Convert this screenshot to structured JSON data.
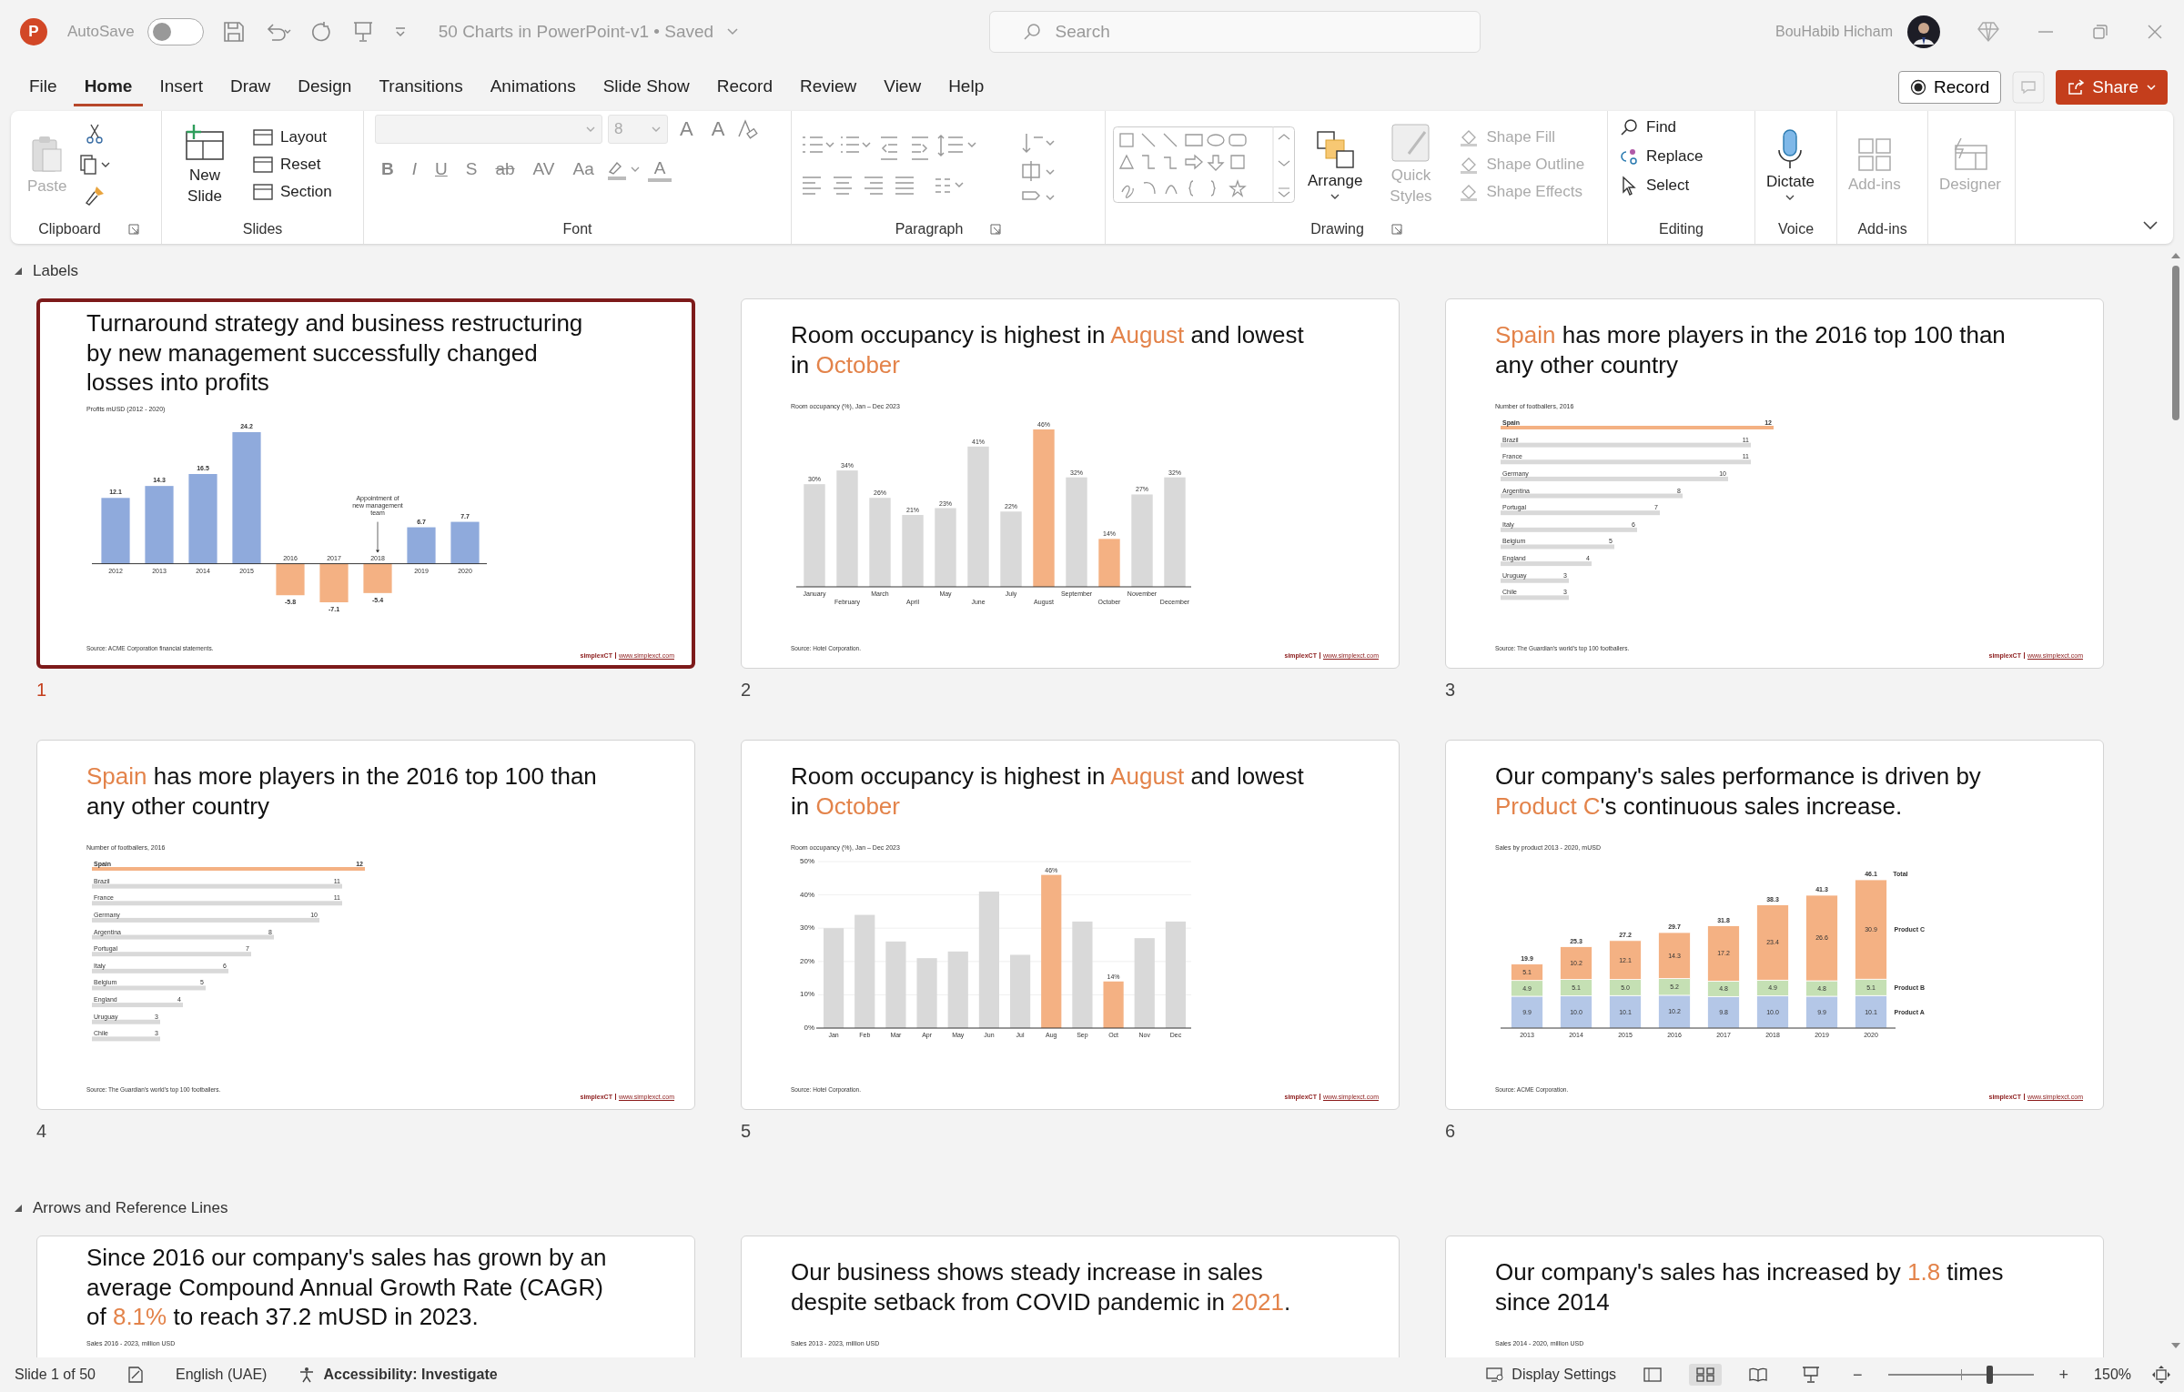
{
  "titlebar": {
    "app_letter": "P",
    "autosave": {
      "label": "AutoSave",
      "on": false
    },
    "document": "50 Charts in PowerPoint-v1 • Saved",
    "search": {
      "placeholder": "Search"
    },
    "user": "BouHabib Hicham"
  },
  "menu": [
    {
      "label": "File",
      "selected": false
    },
    {
      "label": "Home",
      "selected": true
    },
    {
      "label": "Insert",
      "selected": false
    },
    {
      "label": "Draw",
      "selected": false
    },
    {
      "label": "Design",
      "selected": false
    },
    {
      "label": "Transitions",
      "selected": false
    },
    {
      "label": "Animations",
      "selected": false
    },
    {
      "label": "Slide Show",
      "selected": false
    },
    {
      "label": "Record",
      "selected": false
    },
    {
      "label": "Review",
      "selected": false
    },
    {
      "label": "View",
      "selected": false
    },
    {
      "label": "Help",
      "selected": false
    }
  ],
  "record_button": "Record",
  "share_button": "Share",
  "ribbon": {
    "clipboard": {
      "label": "Clipboard",
      "paste": {
        "label": "Paste",
        "disabled": true
      }
    },
    "slides": {
      "label": "Slides",
      "new_slide": "New Slide",
      "items": [
        "Layout",
        "Reset",
        "Section"
      ]
    },
    "font": {
      "label": "Font",
      "size": "8",
      "size_buttons": [
        "A",
        "A"
      ],
      "format_buttons": [
        "B",
        "I",
        "U",
        "S",
        "ab",
        "AV",
        "Aa"
      ],
      "color_letter": "A"
    },
    "paragraph": {
      "label": "Paragraph"
    },
    "drawing": {
      "label": "Drawing",
      "arrange": "Arrange",
      "quick_styles": {
        "label": "Quick Styles",
        "disabled": true
      },
      "shape_items": [
        {
          "label": "Shape Fill",
          "disabled": true
        },
        {
          "label": "Shape Outline",
          "disabled": true
        },
        {
          "label": "Shape Effects",
          "disabled": true
        }
      ]
    },
    "editing": {
      "label": "Editing",
      "items": [
        "Find",
        "Replace",
        "Select"
      ]
    },
    "voice": {
      "label": "Voice",
      "dictate": "Dictate"
    },
    "addins": {
      "label": "Add-ins",
      "button": {
        "label": "Add-ins",
        "disabled": true
      }
    },
    "designer": {
      "button": {
        "label": "Designer",
        "disabled": true
      }
    }
  },
  "sections": [
    {
      "name": "Labels",
      "expanded": true,
      "slides": [
        {
          "number": "1",
          "selected": true,
          "title": [
            {
              "text": "Turnaround strategy and business restructuring by new management successfully changed losses into profits",
              "accent": false
            }
          ],
          "subtitle": "Profits mUSD (2012 - 2020)",
          "source": "Source: ACME Corporation financial statements.",
          "brand": "simplexCT",
          "link": "www.simplexct.com",
          "chart_data": {
            "type": "bar",
            "categories": [
              "2012",
              "2013",
              "2014",
              "2015",
              "2016",
              "2017",
              "2018",
              "2019",
              "2020"
            ],
            "stacked": true,
            "data_labels": true,
            "series": [
              {
                "color": "#8faadc",
                "values": [
                  12.1,
                  14.3,
                  16.5,
                  24.2,
                  null,
                  null,
                  null,
                  6.7,
                  7.7
                ]
              },
              {
                "color": "#f4b183",
                "values": [
                  null,
                  null,
                  null,
                  null,
                  -5.8,
                  -7.1,
                  -5.4,
                  null,
                  null
                ]
              }
            ],
            "annotations": [
              {
                "text": "Appointment of new management team",
                "x": "2018"
              }
            ]
          }
        },
        {
          "number": "2",
          "selected": false,
          "title": [
            {
              "text": "Room occupancy is highest in ",
              "accent": false
            },
            {
              "text": "August",
              "accent": true
            },
            {
              "text": " and lowest in ",
              "accent": false
            },
            {
              "text": "October",
              "accent": true
            }
          ],
          "subtitle": "Room occupancy (%), Jan – Dec 2023",
          "source": "Source: Hotel Corporation.",
          "brand": "simplexCT",
          "link": "www.simplexct.com",
          "chart_data": {
            "type": "bar",
            "categories": [
              "January",
              "February",
              "March",
              "April",
              "May",
              "June",
              "July",
              "August",
              "September",
              "October",
              "November",
              "December"
            ],
            "stacked": true,
            "series": [
              {
                "color": "#d9d9d9",
                "values": [
                  30,
                  34,
                  26,
                  21,
                  23,
                  41,
                  22,
                  null,
                  32,
                  null,
                  27,
                  32
                ],
                "value_labels": [
                  "30%",
                  "34%",
                  "26%",
                  "21%",
                  "23%",
                  "41%",
                  "22%",
                  null,
                  "32%",
                  null,
                  "27%",
                  "32%"
                ]
              },
              {
                "color": "#f4b183",
                "values": [
                  null,
                  null,
                  null,
                  null,
                  null,
                  null,
                  null,
                  46,
                  null,
                  14,
                  null,
                  null
                ],
                "value_labels": [
                  null,
                  null,
                  null,
                  null,
                  null,
                  null,
                  null,
                  "46%",
                  null,
                  "14%",
                  null,
                  null
                ]
              }
            ],
            "data_labels": "value_labels"
          }
        },
        {
          "number": "3",
          "selected": false,
          "title": [
            {
              "text": "Spain",
              "accent": true
            },
            {
              "text": " has more players in the 2016 top 100 than any other country",
              "accent": false
            }
          ],
          "subtitle": "Number of footballers, 2016",
          "source": "Source: The Guardian's world's top 100 footballers.",
          "brand": "simplexCT",
          "link": "www.simplexct.com",
          "chart_data": {
            "type": "bar",
            "orientation": "horizontal",
            "stacked": true,
            "data_labels": true,
            "categories": [
              "Spain",
              "Brazil",
              "France",
              "Germany",
              "Argentina",
              "Portugal",
              "Italy",
              "Belgium",
              "England",
              "Uruguay",
              "Chile"
            ],
            "series": [
              {
                "color": "#d9d9d9",
                "values": [
                  null,
                  11,
                  11,
                  10,
                  8,
                  7,
                  6,
                  5,
                  4,
                  3,
                  3
                ]
              },
              {
                "color": "#f4b183",
                "values": [
                  12,
                  null,
                  null,
                  null,
                  null,
                  null,
                  null,
                  null,
                  null,
                  null,
                  null
                ]
              }
            ]
          }
        },
        {
          "number": "4",
          "selected": false,
          "title": [
            {
              "text": "Spain",
              "accent": true
            },
            {
              "text": " has more players in the 2016 top 100 than any other country",
              "accent": false
            }
          ],
          "subtitle": "Number of footballers, 2016",
          "source": "Source: The Guardian's world's top 100 footballers.",
          "brand": "simplexCT",
          "link": "www.simplexct.com",
          "chart_data": {
            "type": "bar",
            "orientation": "horizontal",
            "stacked": true,
            "data_labels": true,
            "categories": [
              "Spain",
              "Brazil",
              "France",
              "Germany",
              "Argentina",
              "Portugal",
              "Italy",
              "Belgium",
              "England",
              "Uruguay",
              "Chile"
            ],
            "series": [
              {
                "color": "#d9d9d9",
                "values": [
                  null,
                  11,
                  11,
                  10,
                  8,
                  7,
                  6,
                  5,
                  4,
                  3,
                  3
                ]
              },
              {
                "color": "#f4b183",
                "values": [
                  12,
                  null,
                  null,
                  null,
                  null,
                  null,
                  null,
                  null,
                  null,
                  null,
                  null
                ]
              }
            ]
          }
        },
        {
          "number": "5",
          "selected": false,
          "title": [
            {
              "text": "Room occupancy is highest in ",
              "accent": false
            },
            {
              "text": "August",
              "accent": true
            },
            {
              "text": " and lowest in ",
              "accent": false
            },
            {
              "text": "October",
              "accent": true
            }
          ],
          "subtitle": "Room occupancy (%), Jan – Dec 2023",
          "source": "Source: Hotel Corporation.",
          "brand": "simplexCT",
          "link": "www.simplexct.com",
          "chart_data": {
            "type": "bar",
            "categories": [
              "Jan",
              "Feb",
              "Mar",
              "Apr",
              "May",
              "Jun",
              "Jul",
              "Aug",
              "Sep",
              "Oct",
              "Nov",
              "Dec"
            ],
            "stacked": true,
            "ylim": [
              0,
              50
            ],
            "yticks": [
              {
                "value": 0,
                "label": "0%"
              },
              {
                "value": 10,
                "label": "10%"
              },
              {
                "value": 20,
                "label": "20%"
              },
              {
                "value": 30,
                "label": "30%"
              },
              {
                "value": 40,
                "label": "40%"
              },
              {
                "value": 50,
                "label": "50%"
              }
            ],
            "series": [
              {
                "color": "#d9d9d9",
                "values": [
                  30,
                  34,
                  26,
                  21,
                  23,
                  41,
                  22,
                  null,
                  32,
                  null,
                  27,
                  32
                ]
              },
              {
                "color": "#f4b183",
                "values": [
                  null,
                  null,
                  null,
                  null,
                  null,
                  null,
                  null,
                  46,
                  null,
                  14,
                  null,
                  null
                ],
                "value_labels": [
                  null,
                  null,
                  null,
                  null,
                  null,
                  null,
                  null,
                  "46%",
                  null,
                  "14%",
                  null,
                  null
                ]
              }
            ],
            "grid": true,
            "data_labels": "value_labels"
          }
        },
        {
          "number": "6",
          "selected": false,
          "title": [
            {
              "text": "Our company's sales performance is driven by ",
              "accent": false
            },
            {
              "text": "Product C",
              "accent": true
            },
            {
              "text": "'s continuous sales increase.",
              "accent": false
            }
          ],
          "subtitle": "Sales by product 2013 - 2020, mUSD",
          "source": "Source: ACME Corporation.",
          "brand": "simplexCT",
          "link": "www.simplexct.com",
          "chart_data": {
            "type": "bar",
            "categories": [
              "2013",
              "2014",
              "2015",
              "2016",
              "2017",
              "2018",
              "2019",
              "2020"
            ],
            "stacked": true,
            "data_labels": true,
            "value_labels": [
              "19.9",
              "25.3",
              "27.2",
              "29.7",
              "31.8",
              "38.3",
              "41.3",
              "46.1"
            ],
            "series": [
              {
                "name": "Product A",
                "color": "#b4c7e7",
                "values": [
                  9.9,
                  10.0,
                  10.1,
                  10.2,
                  9.8,
                  10.0,
                  9.9,
                  10.1
                ],
                "value_labels": [
                  "9.9",
                  "10.0",
                  "10.1",
                  "10.2",
                  "9.8",
                  "10.0",
                  "9.9",
                  "10.1"
                ]
              },
              {
                "name": "Product B",
                "color": "#c5e0b4",
                "values": [
                  4.9,
                  5.1,
                  5.0,
                  5.2,
                  4.8,
                  4.9,
                  4.8,
                  5.1
                ],
                "value_labels": [
                  "4.9",
                  "5.1",
                  "5.0",
                  "5.2",
                  "4.8",
                  "4.9",
                  "4.8",
                  "5.1"
                ]
              },
              {
                "name": "Product C",
                "color": "#f4b183",
                "values": [
                  5.1,
                  10.2,
                  12.1,
                  14.3,
                  17.2,
                  23.4,
                  26.6,
                  30.9
                ],
                "value_labels": [
                  "5.1",
                  "10.2",
                  "12.1",
                  "14.3",
                  "17.2",
                  "23.4",
                  "26.6",
                  "30.9"
                ]
              }
            ],
            "annotations": [
              {
                "text": "Total"
              }
            ]
          }
        }
      ]
    },
    {
      "name": "Arrows and Reference Lines",
      "expanded": true,
      "slides": [
        {
          "selected": false,
          "title": [
            {
              "text": "Since 2016 our company's sales has grown by an average Compound Annual Growth Rate (CAGR) of ",
              "accent": false
            },
            {
              "text": "8.1%",
              "accent": true
            },
            {
              "text": " to reach 37.2 mUSD in 2023.",
              "accent": false
            }
          ],
          "subtitle": "Sales 2016 - 2023, million USD"
        },
        {
          "selected": false,
          "title": [
            {
              "text": "Our business shows steady increase in sales despite setback from COVID pandemic in ",
              "accent": false
            },
            {
              "text": "2021",
              "accent": true
            },
            {
              "text": ".",
              "accent": false
            }
          ],
          "subtitle": "Sales 2013 - 2023, million USD"
        },
        {
          "selected": false,
          "title": [
            {
              "text": "Our company's sales has increased by ",
              "accent": false
            },
            {
              "text": "1.8",
              "accent": true
            },
            {
              "text": " times since 2014",
              "accent": false
            }
          ],
          "subtitle": "Sales 2014 - 2020, million USD"
        }
      ]
    }
  ],
  "status": {
    "slide": "Slide 1 of 50",
    "language": "English (UAE)",
    "accessibility": "Accessibility: Investigate",
    "display": "Display Settings",
    "views": [
      {
        "kind": "normal",
        "selected": false
      },
      {
        "kind": "sorter",
        "selected": true
      },
      {
        "kind": "reading",
        "selected": false
      },
      {
        "kind": "slideshow",
        "selected": false
      }
    ],
    "zoom_out": "−",
    "zoom_in": "+",
    "zoom": {
      "level": 0.72
    },
    "zoom_text": "150%"
  }
}
